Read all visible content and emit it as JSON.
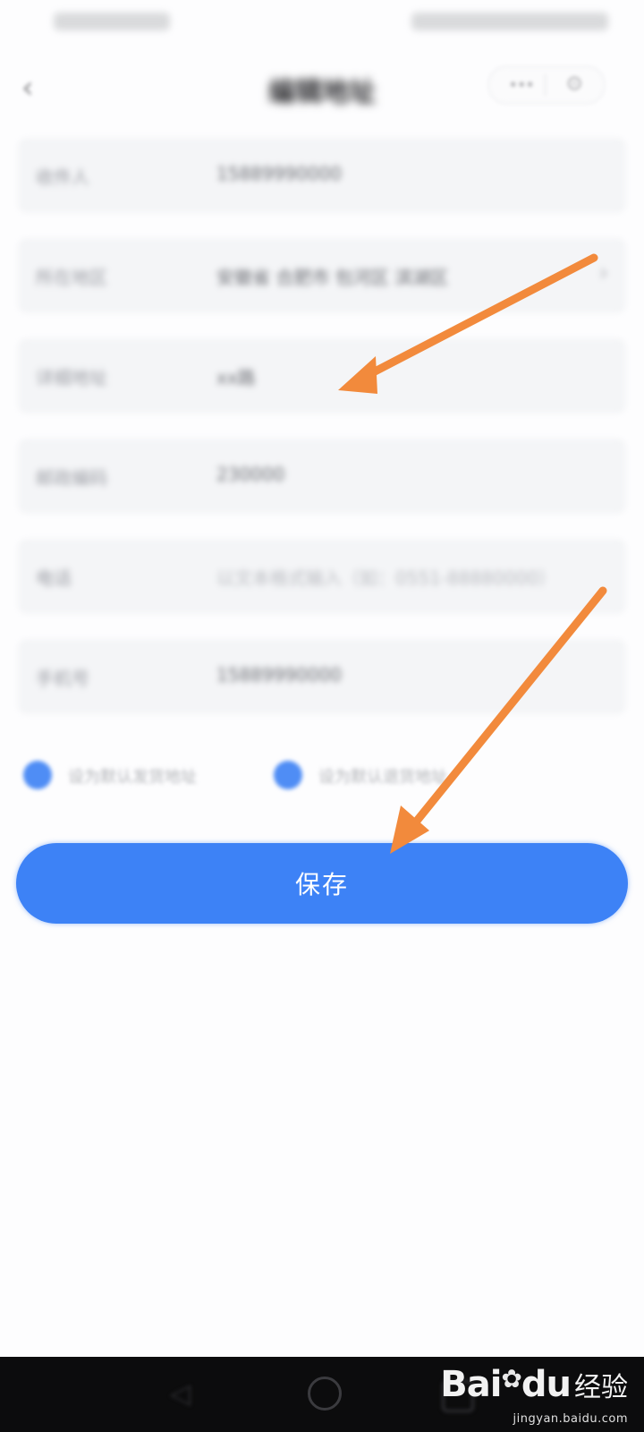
{
  "header": {
    "title": "编辑地址"
  },
  "form": {
    "rows": [
      {
        "label": "收件人",
        "value": "15889990000"
      },
      {
        "label": "所在地区",
        "value": "安徽省 合肥市 包河区 滨湖区"
      },
      {
        "label": "详细地址",
        "value": "xx路"
      },
      {
        "label": "邮政编码",
        "value": "230000"
      },
      {
        "label": "电话",
        "value": "以文本格式输入（如：0551-88880000）"
      },
      {
        "label": "手机号",
        "value": "15889990000"
      }
    ],
    "checks": [
      {
        "label": "设为默认发货地址"
      },
      {
        "label": "设为默认退货地址"
      }
    ]
  },
  "save_button": {
    "label": "保存"
  },
  "annotations": {
    "arrow_color": "#f28a3c"
  },
  "watermark": {
    "logo": "Bai",
    "logo_suffix": "du",
    "name": "经验",
    "url": "jingyan.baidu.com"
  },
  "colors": {
    "accent": "#3d82f6",
    "background": "#fdfdfe",
    "field_bg": "#f4f5f7"
  }
}
